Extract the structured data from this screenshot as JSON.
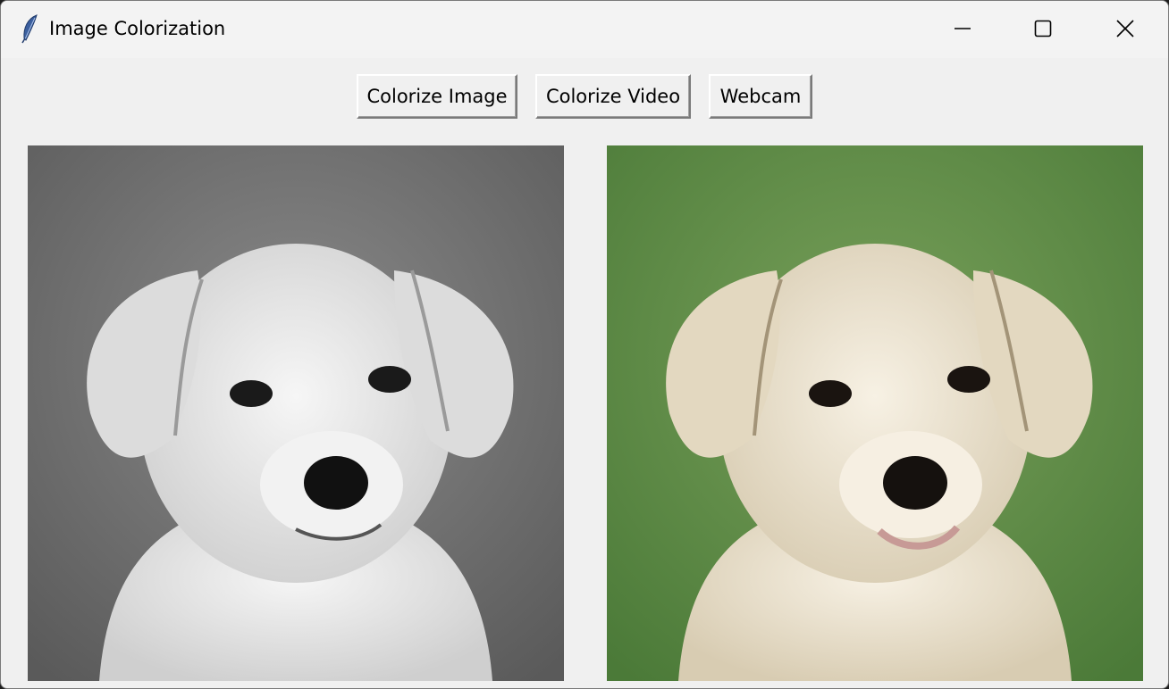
{
  "window": {
    "title": "Image Colorization",
    "icon": "feather-icon"
  },
  "title_controls": [
    "minimize-icon",
    "maximize-icon",
    "close-icon"
  ],
  "toolbar": {
    "colorize_image_label": "Colorize Image",
    "colorize_video_label": "Colorize Video",
    "webcam_label": "Webcam"
  },
  "panels": {
    "left": {
      "description": "grayscale-input-image",
      "background": "#6b6b6b",
      "fur": "#e8e8e8"
    },
    "right": {
      "description": "colorized-output-image",
      "background": "#5f8a45",
      "fur": "#efe6d3"
    }
  },
  "colors": {
    "window_bg": "#f0f0f0",
    "titlebar_bg": "#f3f3f3"
  }
}
